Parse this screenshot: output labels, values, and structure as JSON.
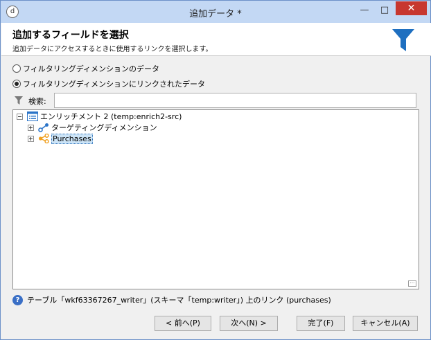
{
  "window": {
    "title": "追加データ *",
    "app_icon_glyph": "d",
    "minimize_glyph": "—",
    "maximize_glyph": "□",
    "close_glyph": "✕"
  },
  "header": {
    "title": "追加するフィールドを選択",
    "subtitle": "追加データにアクセスするときに使用するリンクを選択します。",
    "icon": "funnel-icon",
    "icon_color": "#1e6fc0"
  },
  "options": {
    "filtering_dimension_data": {
      "label": "フィルタリングディメンションのデータ",
      "checked": false
    },
    "linked_data": {
      "label": "フィルタリングディメンションにリンクされたデータ",
      "checked": true
    }
  },
  "search": {
    "label": "検索:",
    "value": "",
    "placeholder": ""
  },
  "tree": {
    "root": {
      "label": "エンリッチメント 2 (temp:enrich2-src)",
      "expanded": true,
      "icon": "list-icon"
    },
    "children": [
      {
        "label": "ターゲティングディメンション",
        "icon": "link-node-icon",
        "icon_color": "#2b74c8"
      },
      {
        "label": "Purchases",
        "icon": "share-node-icon",
        "icon_color": "#f0a020",
        "selected": true
      }
    ],
    "corner_glyph": "···"
  },
  "status": {
    "text": "テーブル「wkf63367267_writer」(スキーマ「temp:writer」) 上のリンク (purchases)"
  },
  "buttons": {
    "back": "< 前へ(P)",
    "next": "次へ(N) >",
    "finish": "完了(F)",
    "cancel": "キャンセル(A)"
  }
}
